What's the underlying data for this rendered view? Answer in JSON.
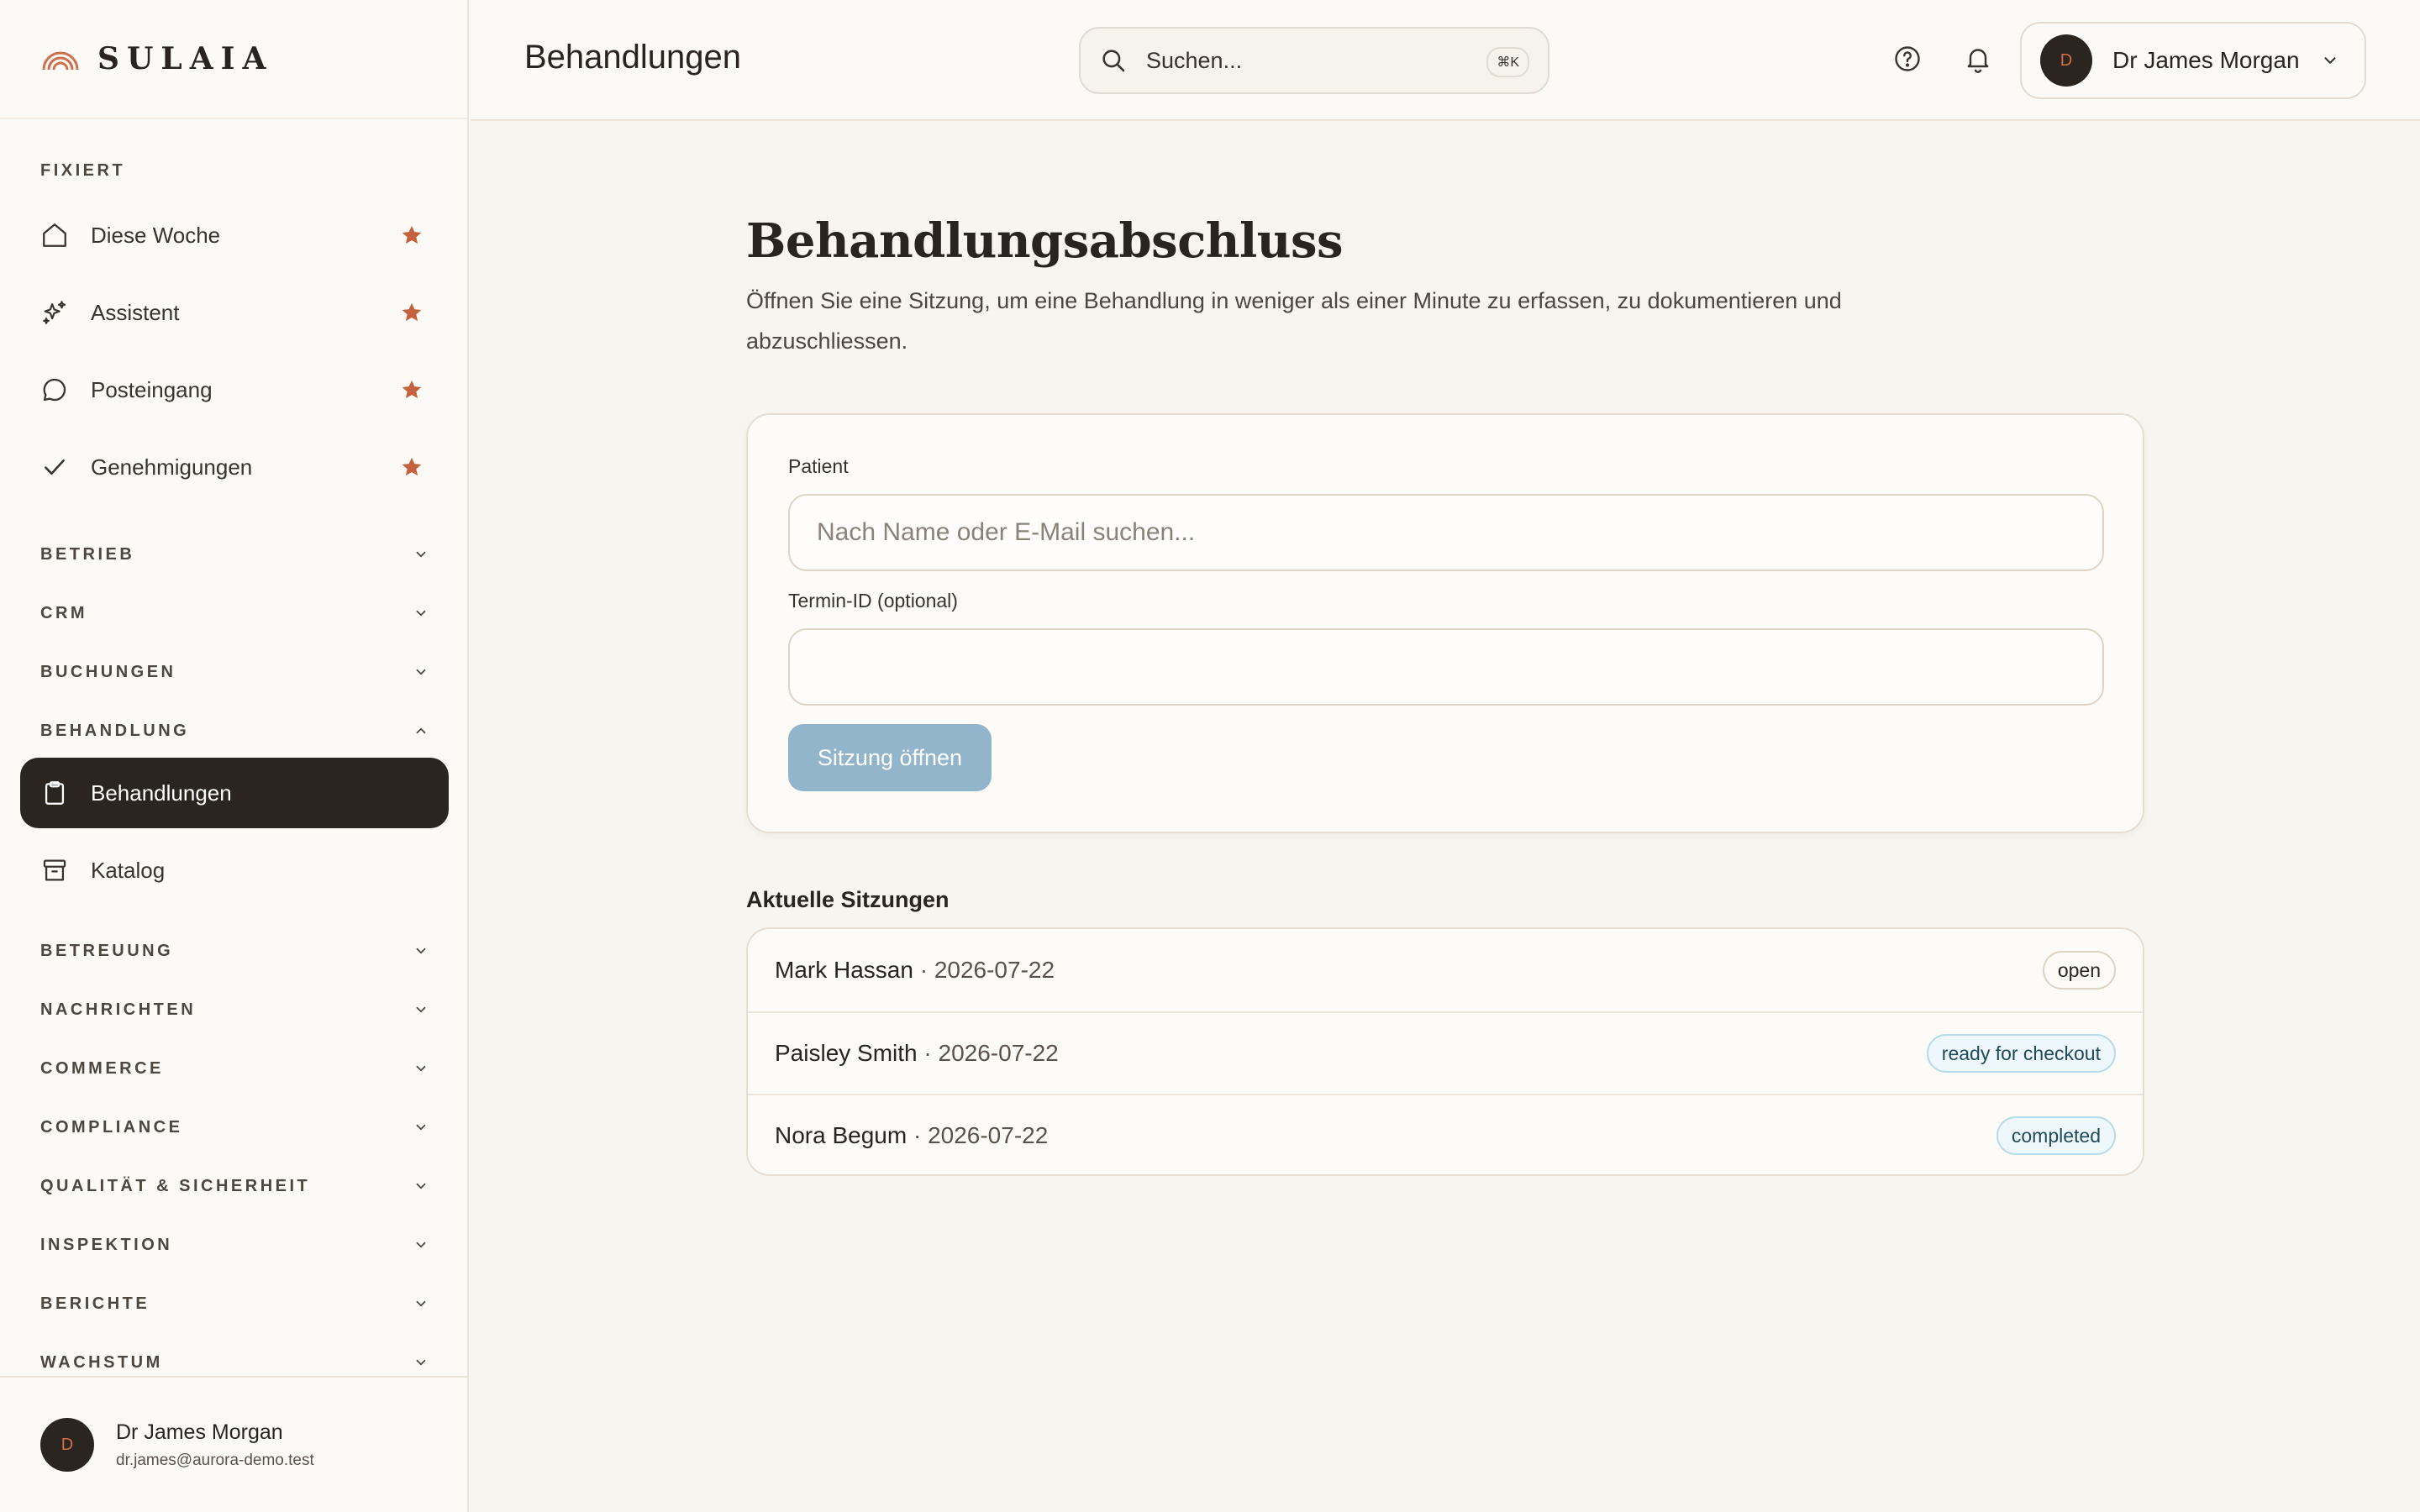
{
  "brand": {
    "name": "SULAIA",
    "accent": "#d0704a"
  },
  "sidebar": {
    "pinned_label": "FIXIERT",
    "pinned": [
      {
        "label": "Diese Woche",
        "icon": "home-icon"
      },
      {
        "label": "Assistent",
        "icon": "sparkles-icon"
      },
      {
        "label": "Posteingang",
        "icon": "chat-bubble-icon"
      },
      {
        "label": "Genehmigungen",
        "icon": "check-icon"
      }
    ],
    "groups": [
      {
        "label": "BETRIEB",
        "expanded": false
      },
      {
        "label": "CRM",
        "expanded": false
      },
      {
        "label": "BUCHUNGEN",
        "expanded": false
      },
      {
        "label": "BEHANDLUNG",
        "expanded": true
      },
      {
        "label": "BETREUUNG",
        "expanded": false
      },
      {
        "label": "NACHRICHTEN",
        "expanded": false
      },
      {
        "label": "COMMERCE",
        "expanded": false
      },
      {
        "label": "COMPLIANCE",
        "expanded": false
      },
      {
        "label": "QUALITÄT & SICHERHEIT",
        "expanded": false
      },
      {
        "label": "INSPEKTION",
        "expanded": false
      },
      {
        "label": "BERICHTE",
        "expanded": false
      },
      {
        "label": "WACHSTUM",
        "expanded": false
      }
    ],
    "behandlung_items": [
      {
        "label": "Behandlungen",
        "icon": "clipboard-icon",
        "active": true
      },
      {
        "label": "Katalog",
        "icon": "archive-box-icon",
        "active": false
      }
    ],
    "footer": {
      "avatar_initial": "D",
      "name": "Dr James Morgan",
      "email": "dr.james@aurora-demo.test"
    }
  },
  "header": {
    "title": "Behandlungen",
    "search": {
      "placeholder": "Suchen...",
      "shortcut": "⌘K"
    },
    "user": {
      "avatar_initial": "D",
      "name": "Dr James Morgan"
    }
  },
  "main": {
    "heading": "Behandlungsabschluss",
    "subtitle": "Öffnen Sie eine Sitzung, um eine Behandlung in weniger als einer Minute zu erfassen, zu dokumentieren und abzuschliessen.",
    "form": {
      "patient_label": "Patient",
      "patient_placeholder": "Nach Name oder E-Mail suchen...",
      "patient_value": "",
      "appointment_label": "Termin-ID (optional)",
      "appointment_value": "",
      "submit_label": "Sitzung öffnen"
    },
    "recent": {
      "title": "Aktuelle Sitzungen",
      "sessions": [
        {
          "name": "Mark Hassan",
          "date": "· 2026-07-22",
          "status": "open"
        },
        {
          "name": "Paisley Smith",
          "date": "· 2026-07-22",
          "status": "ready for checkout"
        },
        {
          "name": "Nora Begum",
          "date": "· 2026-07-22",
          "status": "completed"
        }
      ]
    }
  }
}
